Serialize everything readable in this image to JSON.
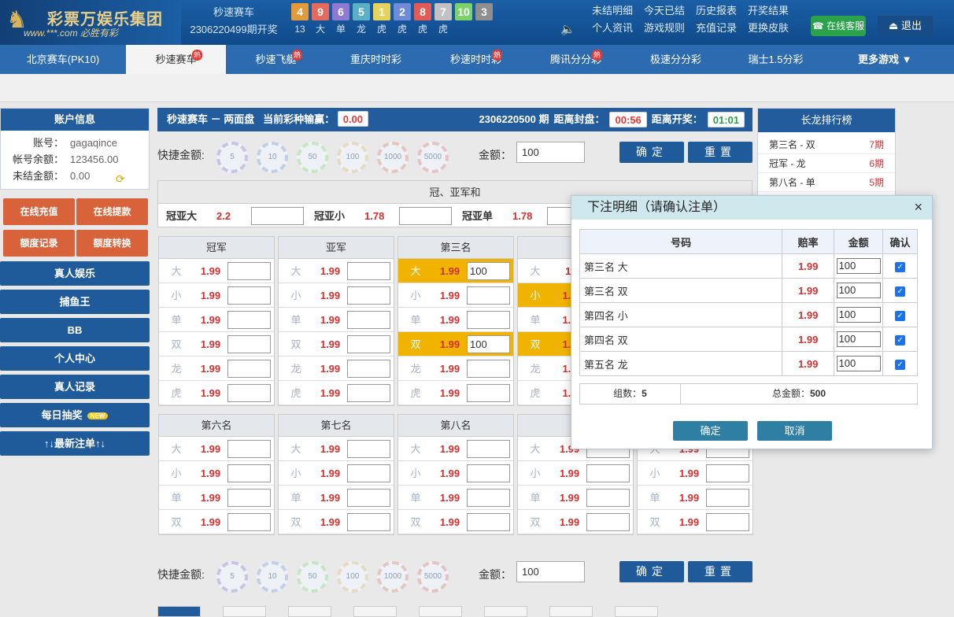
{
  "header": {
    "logo_title": "彩票万娱乐集团",
    "logo_sub": "www.***.com 必胜有彩",
    "current_game": "秒速赛车",
    "last_issue": "2306220499期开奖",
    "result_balls": [
      {
        "n": "4",
        "t": "13",
        "c": "#e39b3a"
      },
      {
        "n": "9",
        "t": "大",
        "c": "#e66a5c"
      },
      {
        "n": "6",
        "t": "单",
        "c": "#8e7ad1"
      },
      {
        "n": "5",
        "t": "龙",
        "c": "#5ab0c6"
      },
      {
        "n": "1",
        "t": "虎",
        "c": "#e6d35a"
      },
      {
        "n": "2",
        "t": "虎",
        "c": "#6d8bd8"
      },
      {
        "n": "8",
        "t": "虎",
        "c": "#e45b55"
      },
      {
        "n": "7",
        "t": "虎",
        "c": "#c2c2c2"
      },
      {
        "n": "10",
        "t": "",
        "c": "#7bd16a"
      },
      {
        "n": "3",
        "t": "",
        "c": "#8f8f8f"
      }
    ],
    "links_row1": [
      "未结明细",
      "今天已结",
      "历史报表",
      "开奖结果"
    ],
    "links_row2": [
      "个人资讯",
      "游戏规则",
      "充值记录",
      "更换皮肤"
    ],
    "service": "在线客服",
    "logout": "退出"
  },
  "tabs": [
    {
      "label": "北京赛车(PK10)",
      "hot": ""
    },
    {
      "label": "秒速赛车",
      "hot": "熱"
    },
    {
      "label": "秒速飞艇",
      "hot": "熱"
    },
    {
      "label": "重庆时时彩",
      "hot": ""
    },
    {
      "label": "秒速时时彩",
      "hot": "熱"
    },
    {
      "label": "腾讯分分彩",
      "hot": "熱"
    },
    {
      "label": "极速分分彩",
      "hot": ""
    },
    {
      "label": "瑞士1.5分彩",
      "hot": ""
    }
  ],
  "more_games": "更多游戏 ▼",
  "account": {
    "title": "账户信息",
    "rows": [
      {
        "k": "账号：",
        "v": "gagaqince"
      },
      {
        "k": "帐号余额：",
        "v": "123456.00"
      },
      {
        "k": "未结金额：",
        "v": "0.00"
      }
    ]
  },
  "side_buttons_orange": [
    "在线充值",
    "在线提款",
    "额度记录",
    "额度转换"
  ],
  "side_buttons_blue": [
    "真人娱乐",
    "捕鱼王",
    "BB",
    "个人中心",
    "真人记录",
    "每日抽奖",
    "↑↓最新注单↑↓"
  ],
  "new_badge": "NEW",
  "main": {
    "title": "秒速赛车 － 两面盘",
    "profit_label": "当前彩种输赢：",
    "profit": "0.00",
    "issue": "2306220500 期",
    "close_label": "距离封盘：",
    "close_time": "00:56",
    "open_label": "距离开奖：",
    "open_time": "01:01",
    "quick_label": "快捷金额:",
    "chips": [
      "5",
      "10",
      "50",
      "100",
      "1000",
      "5000"
    ],
    "amount_label": "金额：",
    "amount": "100",
    "confirm": "确定",
    "reset": "重置"
  },
  "combined": {
    "title": "冠、亚军和",
    "cells": [
      {
        "k": "冠亚大",
        "o": "2.2"
      },
      {
        "k": "冠亚小",
        "o": "1.78"
      },
      {
        "k": "冠亚单",
        "o": "1.78"
      }
    ]
  },
  "ranks_top": [
    {
      "title": "冠军",
      "rows": [
        {
          "k": "大",
          "o": "1.99",
          "v": ""
        },
        {
          "k": "小",
          "o": "1.99",
          "v": ""
        },
        {
          "k": "单",
          "o": "1.99",
          "v": ""
        },
        {
          "k": "双",
          "o": "1.99",
          "v": ""
        },
        {
          "k": "龙",
          "o": "1.99",
          "v": ""
        },
        {
          "k": "虎",
          "o": "1.99",
          "v": ""
        }
      ]
    },
    {
      "title": "亚军",
      "rows": [
        {
          "k": "大",
          "o": "1.99",
          "v": ""
        },
        {
          "k": "小",
          "o": "1.99",
          "v": ""
        },
        {
          "k": "单",
          "o": "1.99",
          "v": ""
        },
        {
          "k": "双",
          "o": "1.99",
          "v": ""
        },
        {
          "k": "龙",
          "o": "1.99",
          "v": ""
        },
        {
          "k": "虎",
          "o": "1.99",
          "v": ""
        }
      ]
    },
    {
      "title": "第三名",
      "rows": [
        {
          "k": "大",
          "o": "1.99",
          "v": "100",
          "hl": true
        },
        {
          "k": "小",
          "o": "1.99",
          "v": ""
        },
        {
          "k": "单",
          "o": "1.99",
          "v": ""
        },
        {
          "k": "双",
          "o": "1.99",
          "v": "100",
          "hl": true
        },
        {
          "k": "龙",
          "o": "1.99",
          "v": ""
        },
        {
          "k": "虎",
          "o": "1.99",
          "v": ""
        }
      ]
    },
    {
      "title": "第",
      "rows": [
        {
          "k": "大",
          "o": "1.",
          "v": ""
        },
        {
          "k": "小",
          "o": "1.9",
          "v": "",
          "hl": true
        },
        {
          "k": "单",
          "o": "1.9",
          "v": ""
        },
        {
          "k": "双",
          "o": "1.9",
          "v": "",
          "hl": true
        },
        {
          "k": "龙",
          "o": "1.9",
          "v": ""
        },
        {
          "k": "虎",
          "o": "1.9",
          "v": ""
        }
      ]
    }
  ],
  "ranks_bottom": [
    {
      "title": "第六名",
      "rows": [
        {
          "k": "大",
          "o": "1.99",
          "v": ""
        },
        {
          "k": "小",
          "o": "1.99",
          "v": ""
        },
        {
          "k": "单",
          "o": "1.99",
          "v": ""
        },
        {
          "k": "双",
          "o": "1.99",
          "v": ""
        }
      ]
    },
    {
      "title": "第七名",
      "rows": [
        {
          "k": "大",
          "o": "1.99",
          "v": ""
        },
        {
          "k": "小",
          "o": "1.99",
          "v": ""
        },
        {
          "k": "单",
          "o": "1.99",
          "v": ""
        },
        {
          "k": "双",
          "o": "1.99",
          "v": ""
        }
      ]
    },
    {
      "title": "第八名",
      "rows": [
        {
          "k": "大",
          "o": "1.99",
          "v": ""
        },
        {
          "k": "小",
          "o": "1.99",
          "v": ""
        },
        {
          "k": "单",
          "o": "1.99",
          "v": ""
        },
        {
          "k": "双",
          "o": "1.99",
          "v": ""
        }
      ]
    },
    {
      "title": "第",
      "rows": [
        {
          "k": "大",
          "o": "1.99",
          "v": ""
        },
        {
          "k": "小",
          "o": "1.99",
          "v": ""
        },
        {
          "k": "单",
          "o": "1.99",
          "v": ""
        },
        {
          "k": "双",
          "o": "1.99",
          "v": ""
        }
      ]
    },
    {
      "title": "",
      "rows": [
        {
          "k": "大",
          "o": "1.99",
          "v": ""
        },
        {
          "k": "小",
          "o": "1.99",
          "v": ""
        },
        {
          "k": "单",
          "o": "1.99",
          "v": ""
        },
        {
          "k": "双",
          "o": "1.99",
          "v": ""
        }
      ]
    }
  ],
  "long_dragon": {
    "title": "长龙排行榜",
    "rows": [
      {
        "k": "第三名 - 双",
        "v": "7期"
      },
      {
        "k": "冠军 - 龙",
        "v": "6期"
      },
      {
        "k": "第八名 - 单",
        "v": "5期"
      }
    ]
  },
  "modal": {
    "title": "下注明细（请确认注单）",
    "close": "×",
    "headers": [
      "号码",
      "赔率",
      "金额",
      "确认"
    ],
    "rows": [
      {
        "num": "第三名 大",
        "odds": "1.99",
        "amt": "100"
      },
      {
        "num": "第三名 双",
        "odds": "1.99",
        "amt": "100"
      },
      {
        "num": "第四名 小",
        "odds": "1.99",
        "amt": "100"
      },
      {
        "num": "第四名 双",
        "odds": "1.99",
        "amt": "100"
      },
      {
        "num": "第五名 龙",
        "odds": "1.99",
        "amt": "100"
      }
    ],
    "group_label": "组数：",
    "group_count": "5",
    "total_label": "总金额：",
    "total": "500",
    "confirm": "确定",
    "cancel": "取消"
  }
}
